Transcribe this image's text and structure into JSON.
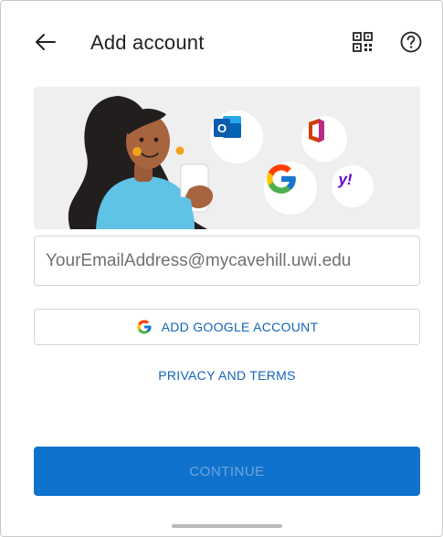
{
  "header": {
    "title": "Add account",
    "back_icon": "arrow-left-icon",
    "qr_icon": "qr-code-icon",
    "help_icon": "help-circle-icon"
  },
  "hero": {
    "illustration": "woman-holding-phone-illustration",
    "apps": [
      "outlook-icon",
      "office-icon",
      "google-icon",
      "yahoo-icon"
    ],
    "apps_text": {
      "outlook": "O",
      "yahoo": "y!"
    }
  },
  "email": {
    "placeholder": "YourEmailAddress@mycavehill.uwi.edu",
    "value": ""
  },
  "google_button": {
    "label": "ADD GOOGLE ACCOUNT"
  },
  "privacy": {
    "label": "PRIVACY AND TERMS"
  },
  "continue_button": {
    "label": "CONTINUE",
    "enabled": false
  },
  "colors": {
    "accent": "#0f72cc",
    "link": "#1265b8",
    "hero_bg": "#efefef",
    "outlook": "#0a64c4",
    "office": "#d83b01",
    "yahoo": "#6001d2"
  }
}
